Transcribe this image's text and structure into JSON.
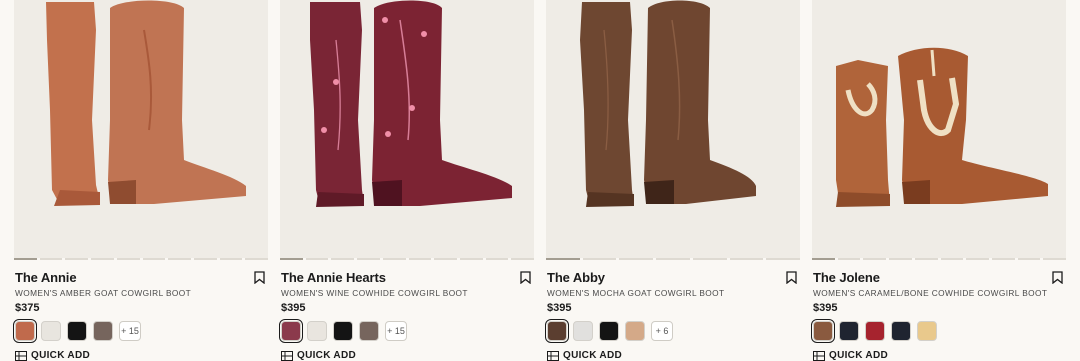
{
  "products": [
    {
      "name": "The Annie",
      "subtitle": "WOMEN'S AMBER GOAT COWGIRL BOOT",
      "price": "$375",
      "boot_color": "#c2714d",
      "boot_shade": "#a9593a",
      "swatches": [
        "#c06a4c",
        "#e8e5df",
        "#141414",
        "#76655d"
      ],
      "more": "+ 15",
      "quick_add": "QUICK ADD"
    },
    {
      "name": "The Annie Hearts",
      "subtitle": "WOMEN'S WINE COWHIDE COWGIRL BOOT",
      "price": "$395",
      "boot_color": "#7a2535",
      "boot_shade": "#5f1a27",
      "swatches": [
        "#8b3a4c",
        "#e9e5df",
        "#141414",
        "#76655d"
      ],
      "more": "+ 15",
      "quick_add": "QUICK ADD"
    },
    {
      "name": "The Abby",
      "subtitle": "WOMEN'S MOCHA GOAT COWGIRL BOOT",
      "price": "$395",
      "boot_color": "#6e4731",
      "boot_shade": "#553422",
      "swatches": [
        "#5b3e30",
        "#e1e0de",
        "#141414",
        "#d4a988"
      ],
      "more": "+ 6",
      "quick_add": "QUICK ADD"
    },
    {
      "name": "The Jolene",
      "subtitle": "WOMEN'S CARAMEL/BONE COWHIDE COWGIRL BOOT",
      "price": "$395",
      "boot_color": "#b0643a",
      "boot_shade": "#8e4c2a",
      "swatches": [
        "#8a5a3f",
        "#1f2430",
        "#a6232e",
        "#1f2430",
        "#e9c98c"
      ],
      "more": "",
      "quick_add": "QUICK ADD"
    }
  ]
}
